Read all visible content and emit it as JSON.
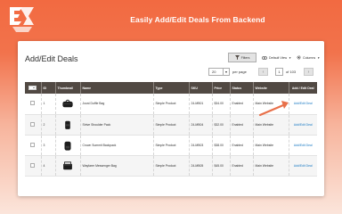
{
  "banner": {
    "title": "Easily Add/Edit Deals From Backend",
    "logo_icon": "brand-logo-icon",
    "accent_color": "#f26a41"
  },
  "page": {
    "title": "Add/Edit Deals"
  },
  "toolbar": {
    "filters_label": "Filters",
    "view_label": "Default View",
    "columns_label": "Columns"
  },
  "pager": {
    "per_page_value": "20",
    "per_page_label": "per page",
    "current_page": "1",
    "of_label": "of 103"
  },
  "grid": {
    "columns": [
      "ID",
      "Thumbnail",
      "Name",
      "Type",
      "SKU",
      "Price",
      "Status",
      "Website",
      "Add / Edit Deal"
    ],
    "rows": [
      {
        "id": "1",
        "name": "Joust Duffle Bag",
        "type": "Simple Product",
        "sku": "24-MB01",
        "price": "$34.00",
        "status": "Enabled",
        "website": "Main Website",
        "action": "Add/Edit Deal"
      },
      {
        "id": "2",
        "name": "Strive Shoulder Pack",
        "type": "Simple Product",
        "sku": "24-MB04",
        "price": "$32.00",
        "status": "Enabled",
        "website": "Main Website",
        "action": "Add/Edit Deal"
      },
      {
        "id": "3",
        "name": "Crown Summit Backpack",
        "type": "Simple Product",
        "sku": "24-MB03",
        "price": "$38.00",
        "status": "Enabled",
        "website": "Main Website",
        "action": "Add/Edit Deal"
      },
      {
        "id": "4",
        "name": "Wayfarer Messenger Bag",
        "type": "Simple Product",
        "sku": "24-MB05",
        "price": "$45.00",
        "status": "Enabled",
        "website": "Main Website",
        "action": "Add/Edit Deal"
      }
    ]
  }
}
